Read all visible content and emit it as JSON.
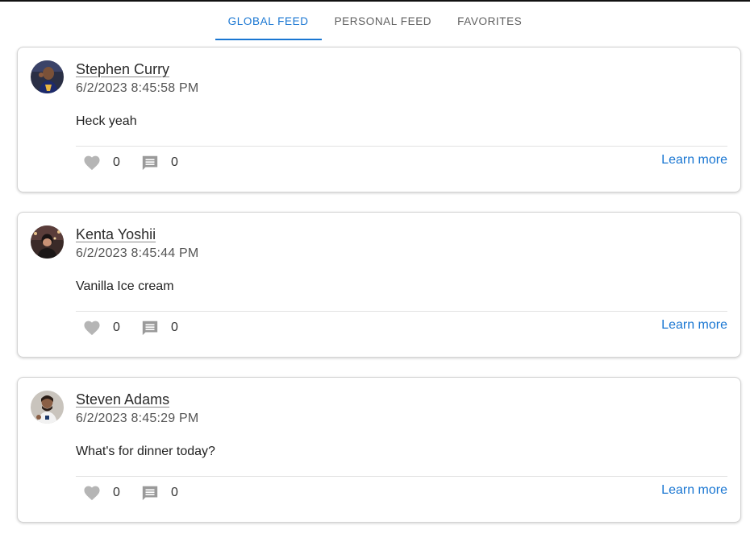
{
  "tabs": [
    {
      "label": "GLOBAL FEED",
      "active": true
    },
    {
      "label": "PERSONAL FEED",
      "active": false
    },
    {
      "label": "FAVORITES",
      "active": false
    }
  ],
  "posts": [
    {
      "author": "Stephen Curry",
      "timestamp": "6/2/2023 8:45:58 PM",
      "text": "Heck yeah",
      "likes": "0",
      "comments": "0",
      "action_label": "Learn more"
    },
    {
      "author": "Kenta Yoshii",
      "timestamp": "6/2/2023 8:45:44 PM",
      "text": "Vanilla Ice cream",
      "likes": "0",
      "comments": "0",
      "action_label": "Learn more"
    },
    {
      "author": "Steven Adams",
      "timestamp": "6/2/2023 8:45:29 PM",
      "text": "What's for dinner today?",
      "likes": "0",
      "comments": "0",
      "action_label": "Learn more"
    }
  ],
  "icons": {
    "like": "heart-icon",
    "comment": "comment-icon"
  },
  "colors": {
    "accent": "#1976d2",
    "icon_gray": "#b5b5b5"
  }
}
